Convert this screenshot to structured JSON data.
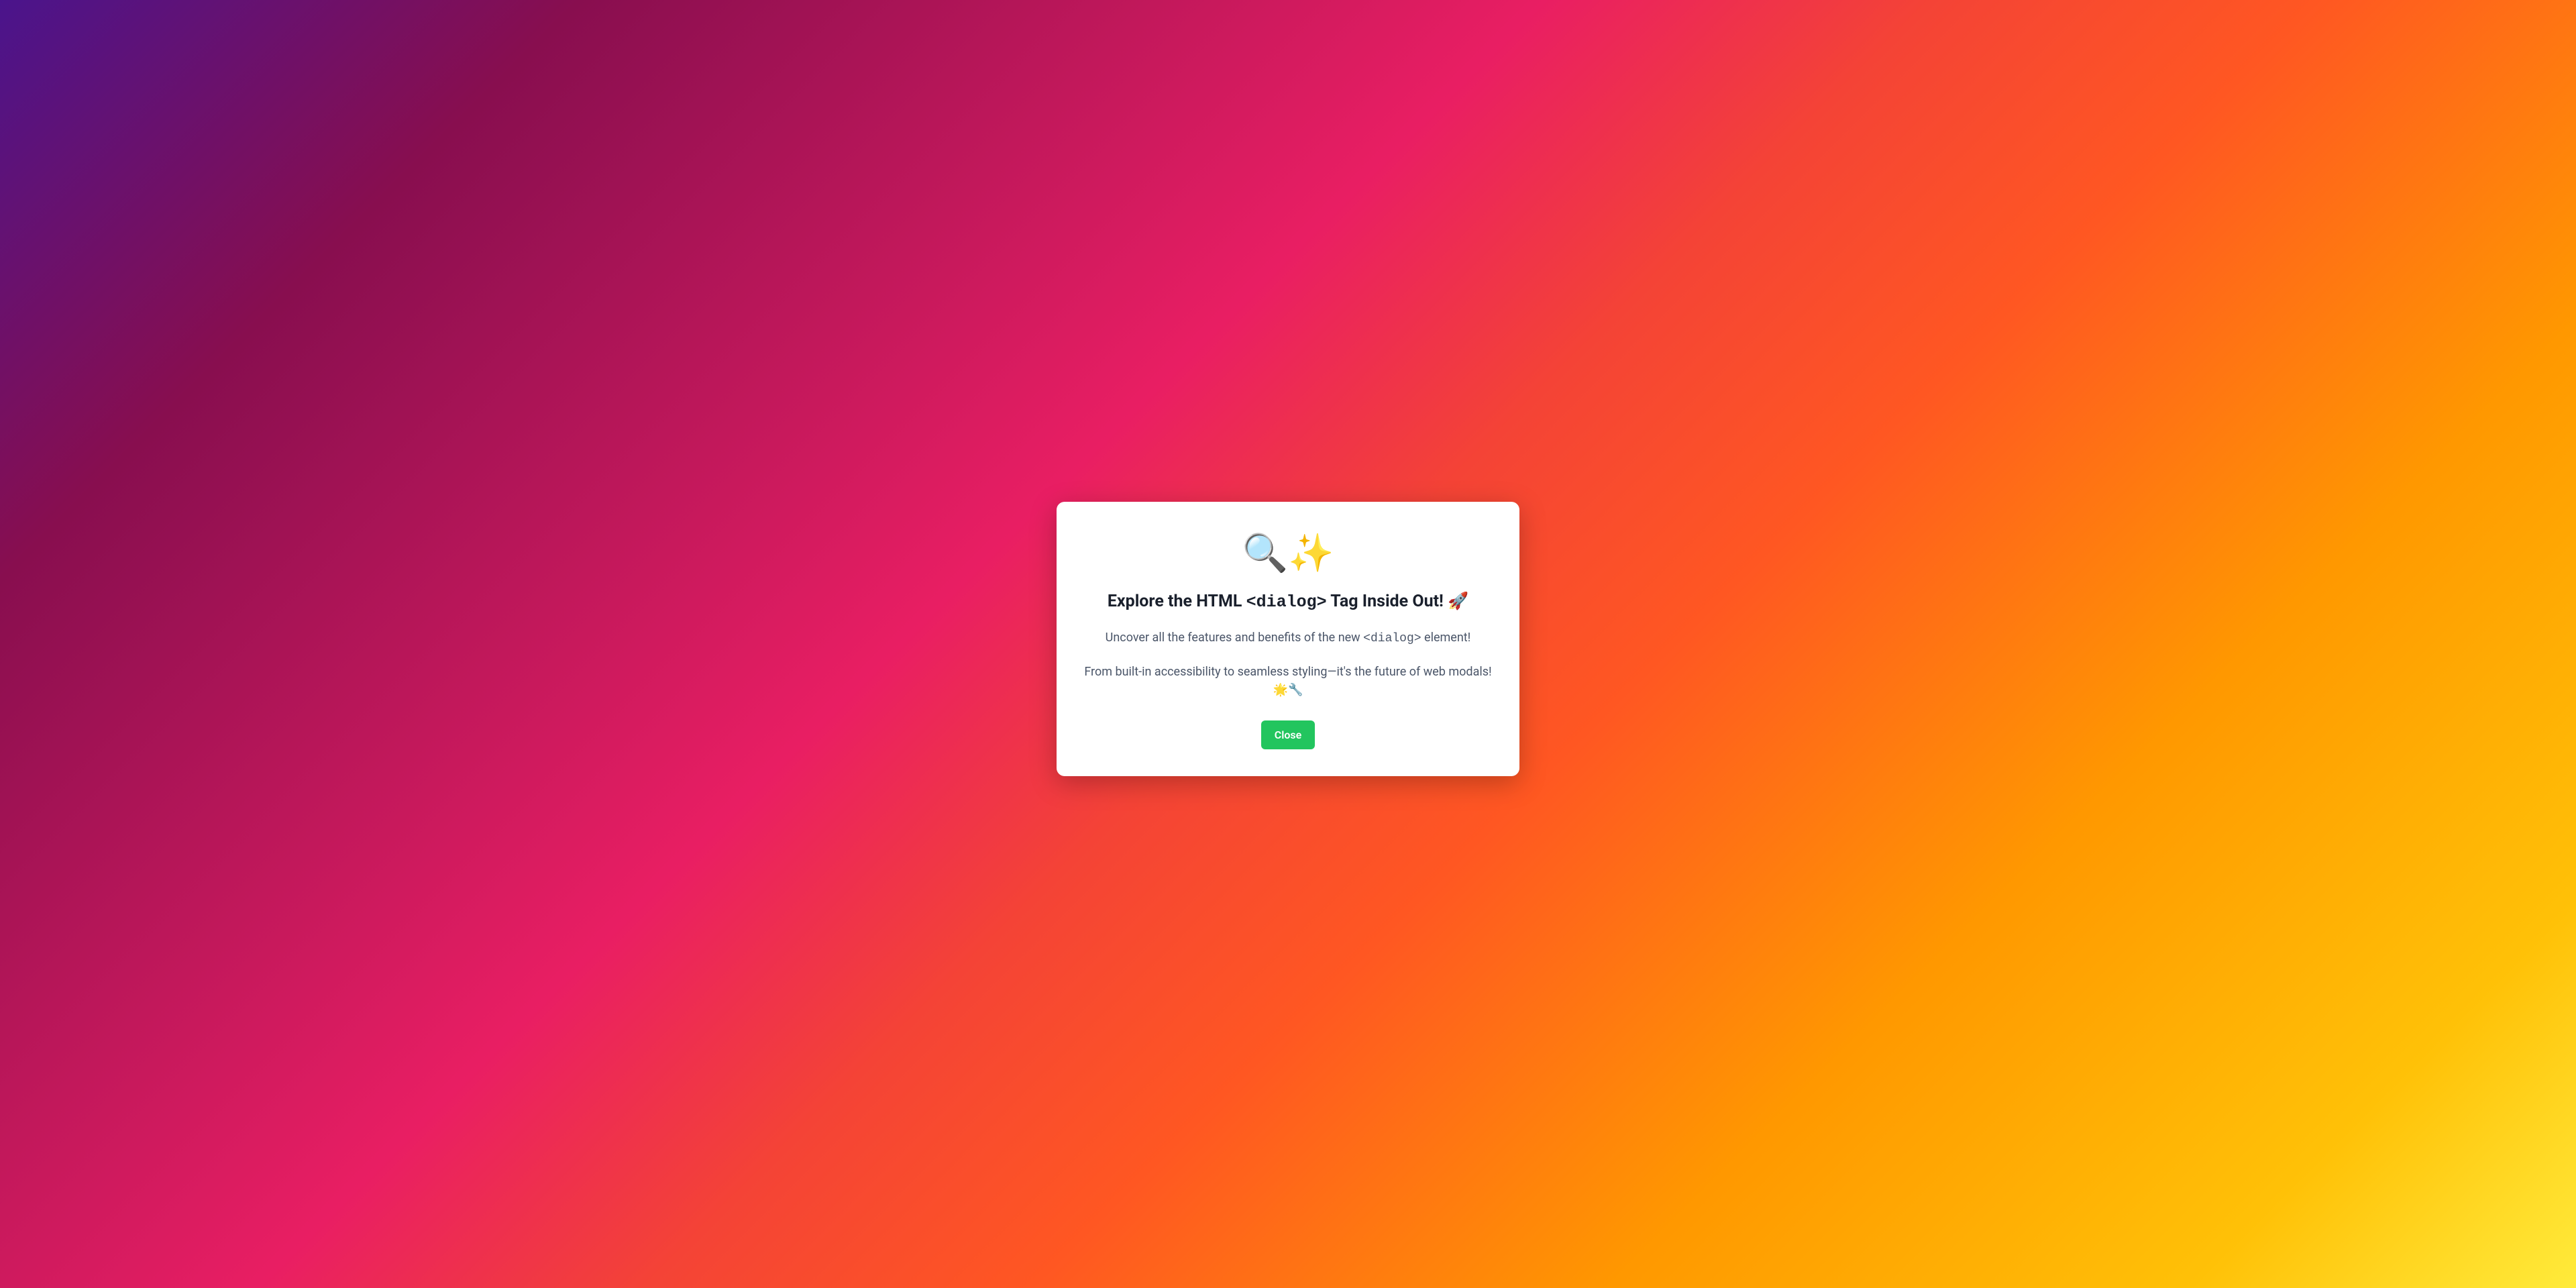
{
  "dialog": {
    "icons": "🔍✨",
    "title_prefix": "Explore the HTML ",
    "title_code": "<dialog>",
    "title_suffix": " Tag Inside Out! 🚀",
    "body1_prefix": "Uncover all the features and benefits of the new ",
    "body1_code": "<dialog>",
    "body1_suffix": " element!",
    "body2": "From built-in accessibility to seamless styling—it's the future of web modals! 🌟🔧",
    "close_label": "Close"
  }
}
